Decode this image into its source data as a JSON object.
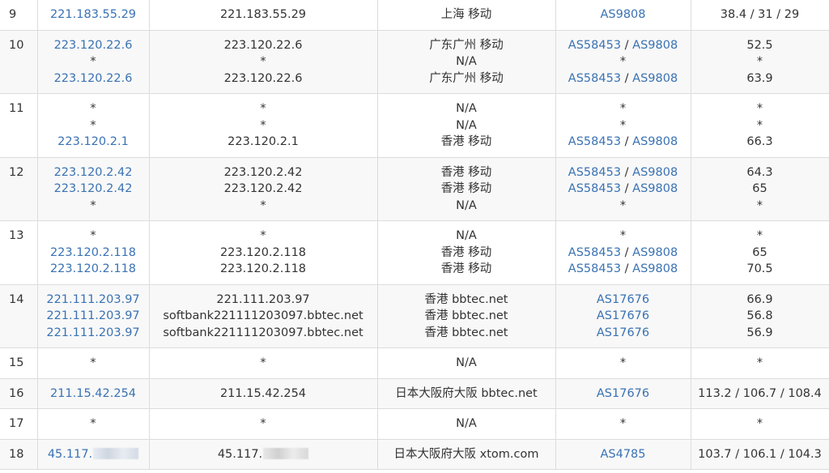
{
  "rows": [
    {
      "hop": "9",
      "ip": [
        "221.183.55.29"
      ],
      "host": [
        "221.183.55.29"
      ],
      "loc": [
        "上海 移动"
      ],
      "asn": [
        [
          "AS9808"
        ]
      ],
      "rtt": [
        "38.4 / 31 / 29"
      ]
    },
    {
      "hop": "10",
      "ip": [
        "223.120.22.6",
        "*",
        "223.120.22.6"
      ],
      "host": [
        "223.120.22.6",
        "*",
        "223.120.22.6"
      ],
      "loc": [
        "广东广州 移动",
        "N/A",
        "广东广州 移动"
      ],
      "asn": [
        [
          "AS58453",
          "AS9808"
        ],
        [
          "*"
        ],
        [
          "AS58453",
          "AS9808"
        ]
      ],
      "rtt": [
        "52.5",
        "*",
        "63.9"
      ]
    },
    {
      "hop": "11",
      "ip": [
        "*",
        "*",
        "223.120.2.1"
      ],
      "host": [
        "*",
        "*",
        "223.120.2.1"
      ],
      "loc": [
        "N/A",
        "N/A",
        "香港 移动"
      ],
      "asn": [
        [
          "*"
        ],
        [
          "*"
        ],
        [
          "AS58453",
          "AS9808"
        ]
      ],
      "rtt": [
        "*",
        "*",
        "66.3"
      ]
    },
    {
      "hop": "12",
      "ip": [
        "223.120.2.42",
        "223.120.2.42",
        "*"
      ],
      "host": [
        "223.120.2.42",
        "223.120.2.42",
        "*"
      ],
      "loc": [
        "香港 移动",
        "香港 移动",
        "N/A"
      ],
      "asn": [
        [
          "AS58453",
          "AS9808"
        ],
        [
          "AS58453",
          "AS9808"
        ],
        [
          "*"
        ]
      ],
      "rtt": [
        "64.3",
        "65",
        "*"
      ]
    },
    {
      "hop": "13",
      "ip": [
        "*",
        "223.120.2.118",
        "223.120.2.118"
      ],
      "host": [
        "*",
        "223.120.2.118",
        "223.120.2.118"
      ],
      "loc": [
        "N/A",
        "香港 移动",
        "香港 移动"
      ],
      "asn": [
        [
          "*"
        ],
        [
          "AS58453",
          "AS9808"
        ],
        [
          "AS58453",
          "AS9808"
        ]
      ],
      "rtt": [
        "*",
        "65",
        "70.5"
      ]
    },
    {
      "hop": "14",
      "ip": [
        "221.111.203.97",
        "221.111.203.97",
        "221.111.203.97"
      ],
      "host": [
        "221.111.203.97",
        "softbank221111203097.bbtec.net",
        "softbank221111203097.bbtec.net"
      ],
      "loc": [
        "香港 bbtec.net",
        "香港 bbtec.net",
        "香港 bbtec.net"
      ],
      "asn": [
        [
          "AS17676"
        ],
        [
          "AS17676"
        ],
        [
          "AS17676"
        ]
      ],
      "rtt": [
        "66.9",
        "56.8",
        "56.9"
      ]
    },
    {
      "hop": "15",
      "ip": [
        "*"
      ],
      "host": [
        "*"
      ],
      "loc": [
        "N/A"
      ],
      "asn": [
        [
          "*"
        ]
      ],
      "rtt": [
        "*"
      ]
    },
    {
      "hop": "16",
      "ip": [
        "211.15.42.254"
      ],
      "host": [
        "211.15.42.254"
      ],
      "loc": [
        "日本大阪府大阪 bbtec.net"
      ],
      "asn": [
        [
          "AS17676"
        ]
      ],
      "rtt": [
        "113.2 / 106.7 / 108.4"
      ]
    },
    {
      "hop": "17",
      "ip": [
        "*"
      ],
      "host": [
        "*"
      ],
      "loc": [
        "N/A"
      ],
      "asn": [
        [
          "*"
        ]
      ],
      "rtt": [
        "*"
      ]
    },
    {
      "hop": "18",
      "ip": [
        "45.117."
      ],
      "host": [
        "45.117."
      ],
      "loc": [
        "日本大阪府大阪 xtom.com"
      ],
      "asn": [
        [
          "AS4785"
        ]
      ],
      "rtt": [
        "103.7 / 106.1 / 104.3"
      ],
      "redacted": true
    }
  ],
  "asn_separator": " / "
}
